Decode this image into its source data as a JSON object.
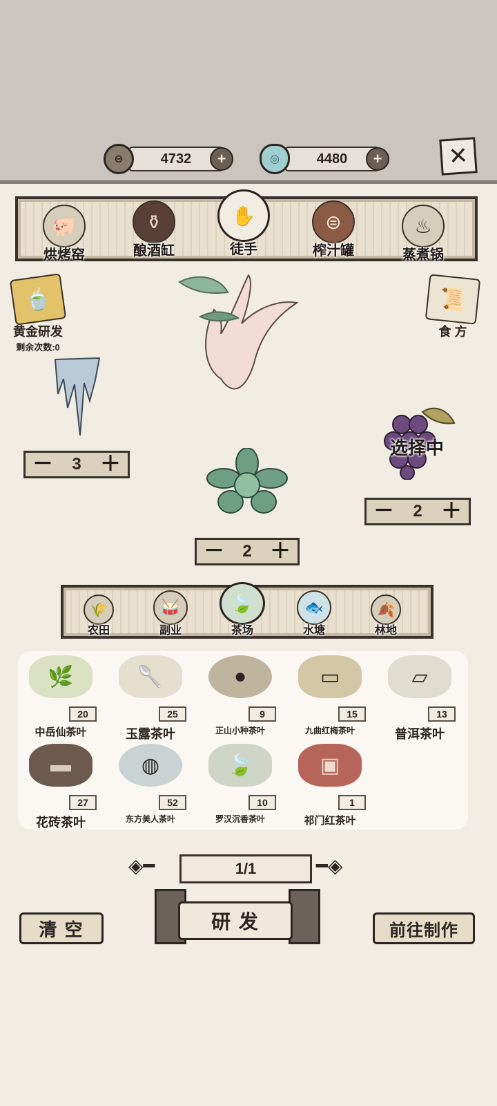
{
  "currency": {
    "coins": "4732",
    "gems": "4480",
    "coin_icon": "coin-icon",
    "gem_icon": "gem-icon"
  },
  "tools": [
    {
      "label": "烘烤窑"
    },
    {
      "label": "酿酒缸"
    },
    {
      "label": "徒手"
    },
    {
      "label": "榨汁罐"
    },
    {
      "label": "蒸煮锅"
    }
  ],
  "gold_research": {
    "label": "黄金研发",
    "remaining": "剩余次数:0"
  },
  "recipe": {
    "label": "食 方"
  },
  "slots": {
    "left": {
      "value": "3"
    },
    "center": {
      "value": "2"
    },
    "right": {
      "value": "2",
      "status": "选择中"
    }
  },
  "categories": [
    {
      "label": "农田"
    },
    {
      "label": "副业"
    },
    {
      "label": "茶场"
    },
    {
      "label": "水塘"
    },
    {
      "label": "林地"
    }
  ],
  "items": [
    {
      "name": "中岳仙茶叶",
      "count": "20"
    },
    {
      "name": "玉露茶叶",
      "count": "25"
    },
    {
      "name": "正山小种茶叶",
      "count": "9"
    },
    {
      "name": "九曲红梅茶叶",
      "count": "15"
    },
    {
      "name": "普洱茶叶",
      "count": "13"
    },
    {
      "name": "花砖茶叶",
      "count": "27"
    },
    {
      "name": "东方美人茶叶",
      "count": "52"
    },
    {
      "name": "罗汉沉香茶叶",
      "count": "10"
    },
    {
      "name": "祁门红茶叶",
      "count": "1"
    }
  ],
  "pagination": {
    "label": "1/1"
  },
  "actions": {
    "clear": "清 空",
    "research": "研 发",
    "goto": "前往制作"
  },
  "colors": {
    "bg": "#f2ede3",
    "top": "#cbc6bd",
    "ink": "#2b2420"
  }
}
